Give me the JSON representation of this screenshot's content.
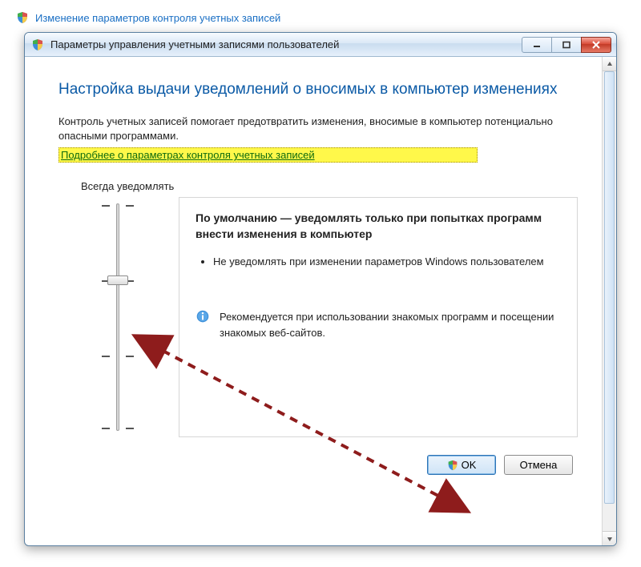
{
  "top_link": "Изменение параметров контроля учетных записей",
  "window": {
    "title": "Параметры управления учетными записями пользователей"
  },
  "page": {
    "heading": "Настройка выдачи уведомлений о вносимых в компьютер изменениях",
    "intro": "Контроль учетных записей помогает предотвратить изменения, вносимые в компьютер потенциально опасными программами.",
    "help_link": "Подробнее о параметрах контроля учетных записей",
    "always_notify_label": "Всегда уведомлять"
  },
  "slider": {
    "tick_count": 4,
    "thumb_index": 1
  },
  "description": {
    "title": "По умолчанию — уведомлять только при попытках программ внести изменения в компьютер",
    "bullet1": "Не уведомлять при изменении параметров Windows пользователем",
    "recommendation": "Рекомендуется при использовании знакомых программ и посещении знакомых веб-сайтов."
  },
  "buttons": {
    "ok": "OK",
    "cancel": "Отмена"
  },
  "icons": {
    "shield": "shield",
    "info": "info",
    "minimize": "minimize",
    "maximize": "maximize",
    "close": "close",
    "up": "up",
    "down": "down"
  }
}
